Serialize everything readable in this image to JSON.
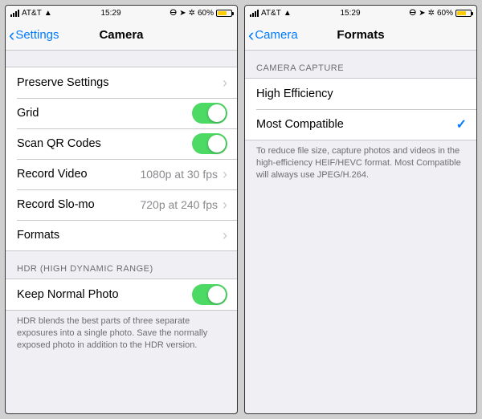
{
  "left": {
    "status": {
      "carrier": "AT&T",
      "time": "15:29",
      "battery_percent": "60%"
    },
    "nav": {
      "back_label": "Settings",
      "title": "Camera"
    },
    "rows": {
      "preserve": {
        "label": "Preserve Settings"
      },
      "grid": {
        "label": "Grid"
      },
      "scanqr": {
        "label": "Scan QR Codes"
      },
      "record_video": {
        "label": "Record Video",
        "detail": "1080p at 30 fps"
      },
      "record_slomo": {
        "label": "Record Slo-mo",
        "detail": "720p at 240 fps"
      },
      "formats": {
        "label": "Formats"
      }
    },
    "hdr": {
      "header": "HDR (HIGH DYNAMIC RANGE)",
      "keep_normal": {
        "label": "Keep Normal Photo"
      },
      "footer": "HDR blends the best parts of three separate exposures into a single photo. Save the normally exposed photo in addition to the HDR version."
    }
  },
  "right": {
    "status": {
      "carrier": "AT&T",
      "time": "15:29",
      "battery_percent": "60%"
    },
    "nav": {
      "back_label": "Camera",
      "title": "Formats"
    },
    "capture": {
      "header": "CAMERA CAPTURE",
      "high_eff": {
        "label": "High Efficiency"
      },
      "most_compat": {
        "label": "Most Compatible"
      },
      "footer": "To reduce file size, capture photos and videos in the high-efficiency HEIF/HEVC format. Most Compatible will always use JPEG/H.264."
    }
  }
}
